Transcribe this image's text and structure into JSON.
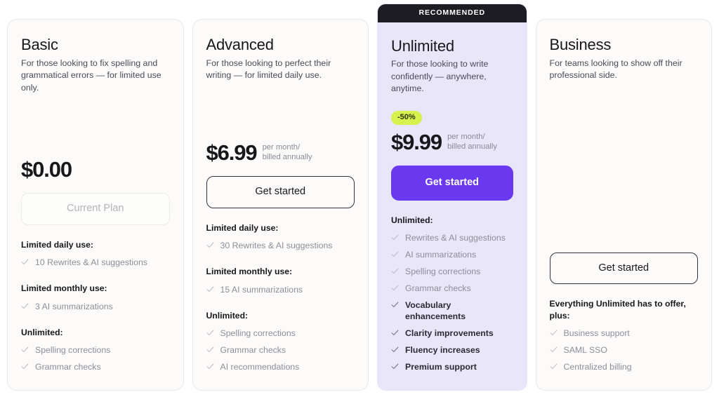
{
  "theme": {
    "page_background": "#ffffff",
    "card_background": "#fcfbfa",
    "featured_background": "#e9e6fa",
    "banner_background": "#1c1c22",
    "accent_purple": "#6938ef",
    "badge_lime": "#d7f14f"
  },
  "plans": [
    {
      "id": "basic",
      "name": "Basic",
      "tagline": "For those looking to fix spelling and grammatical errors — for limited use only.",
      "badge": null,
      "price": "$0.00",
      "price_note": "",
      "cta_label": "Current Plan",
      "cta_state": "disabled",
      "feature_groups": [
        {
          "title": "Limited daily use:",
          "items": [
            {
              "label": "10 Rewrites & AI suggestions",
              "emphasis": false
            }
          ]
        },
        {
          "title": "Limited monthly use:",
          "items": [
            {
              "label": "3 AI summarizations",
              "emphasis": false
            }
          ]
        },
        {
          "title": "Unlimited:",
          "items": [
            {
              "label": "Spelling corrections",
              "emphasis": false
            },
            {
              "label": "Grammar checks",
              "emphasis": false
            }
          ]
        }
      ]
    },
    {
      "id": "advanced",
      "name": "Advanced",
      "tagline": "For those looking to perfect their writing — for limited daily use.",
      "badge": null,
      "price": "$6.99",
      "price_note": "per month/ billed annually",
      "cta_label": "Get started",
      "cta_state": "outline",
      "feature_groups": [
        {
          "title": "Limited daily use:",
          "items": [
            {
              "label": "30 Rewrites & AI suggestions",
              "emphasis": false
            }
          ]
        },
        {
          "title": "Limited monthly use:",
          "items": [
            {
              "label": "15 AI summarizations",
              "emphasis": false
            }
          ]
        },
        {
          "title": "Unlimited:",
          "items": [
            {
              "label": "Spelling corrections",
              "emphasis": false
            },
            {
              "label": "Grammar checks",
              "emphasis": false
            },
            {
              "label": "AI recommendations",
              "emphasis": false
            }
          ]
        }
      ]
    },
    {
      "id": "unlimited",
      "name": "Unlimited",
      "tagline": "For those looking to write confidently — anywhere, anytime.",
      "banner_label": "RECOMMENDED",
      "badge": "-50%",
      "price": "$9.99",
      "price_note": "per month/  billed annually",
      "cta_label": "Get started",
      "cta_state": "primary",
      "feature_groups": [
        {
          "title": "Unlimited:",
          "items": [
            {
              "label": "Rewrites & AI suggestions",
              "emphasis": false
            },
            {
              "label": "AI summarizations",
              "emphasis": false
            },
            {
              "label": "Spelling corrections",
              "emphasis": false
            },
            {
              "label": "Grammar checks",
              "emphasis": false
            },
            {
              "label": "Vocabulary enhancements",
              "emphasis": true
            },
            {
              "label": "Clarity improvements",
              "emphasis": true
            },
            {
              "label": "Fluency increases",
              "emphasis": true
            },
            {
              "label": "Premium support",
              "emphasis": true
            }
          ]
        }
      ]
    },
    {
      "id": "business",
      "name": "Business",
      "tagline": "For teams looking to show off their professional side.",
      "badge": null,
      "price": "",
      "price_note": "",
      "cta_label": "Get started",
      "cta_state": "outline",
      "feature_groups": [
        {
          "title": "Everything Unlimited has to offer, plus:",
          "items": [
            {
              "label": "Business support",
              "emphasis": false
            },
            {
              "label": "SAML SSO",
              "emphasis": false
            },
            {
              "label": "Centralized billing",
              "emphasis": false
            }
          ]
        }
      ]
    }
  ]
}
